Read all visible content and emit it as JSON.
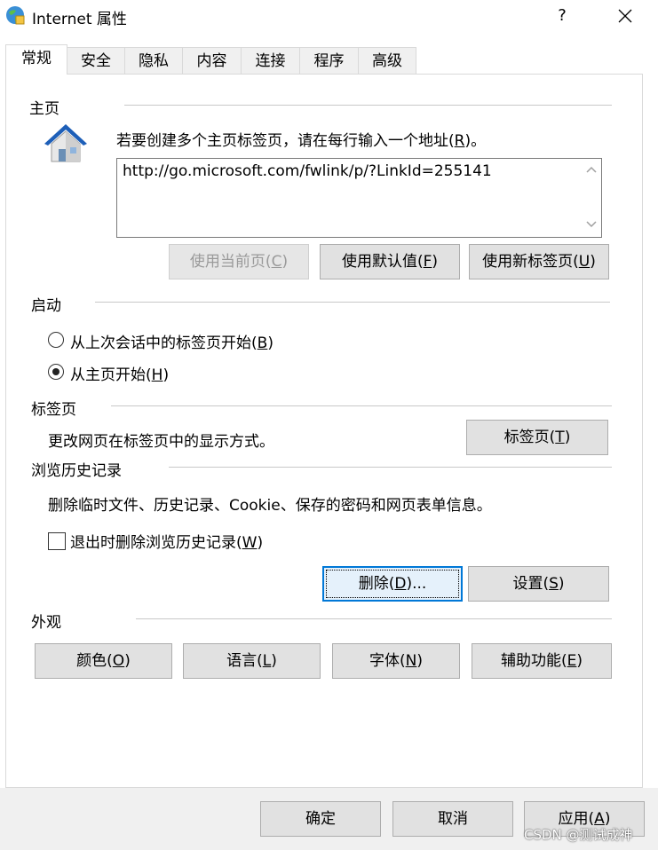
{
  "window": {
    "title": "Internet 属性",
    "help": "?",
    "close": "✕"
  },
  "tabs": [
    {
      "label": "常规",
      "active": true
    },
    {
      "label": "安全",
      "active": false
    },
    {
      "label": "隐私",
      "active": false
    },
    {
      "label": "内容",
      "active": false
    },
    {
      "label": "连接",
      "active": false
    },
    {
      "label": "程序",
      "active": false
    },
    {
      "label": "高级",
      "active": false
    }
  ],
  "home": {
    "section": "主页",
    "instruction_pre": "若要创建多个主页标签页，请在每行输入一个地址(",
    "instruction_key": "R",
    "instruction_post": ")。",
    "url_value": "http://go.microsoft.com/fwlink/p/?LinkId=255141",
    "btn_current": {
      "pre": "使用当前页(",
      "key": "C",
      "post": ")"
    },
    "btn_default": {
      "pre": "使用默认值(",
      "key": "F",
      "post": ")"
    },
    "btn_newtab": {
      "pre": "使用新标签页(",
      "key": "U",
      "post": ")"
    }
  },
  "startup": {
    "section": "启动",
    "opt_last": {
      "pre": "从上次会话中的标签页开始(",
      "key": "B",
      "post": ")"
    },
    "opt_home": {
      "pre": "从主页开始(",
      "key": "H",
      "post": ")"
    }
  },
  "tabs_section": {
    "section": "标签页",
    "desc": "更改网页在标签页中的显示方式。",
    "btn": {
      "pre": "标签页(",
      "key": "T",
      "post": ")"
    }
  },
  "history": {
    "section": "浏览历史记录",
    "desc": "删除临时文件、历史记录、Cookie、保存的密码和网页表单信息。",
    "checkbox": {
      "pre": "退出时删除浏览历史记录(",
      "key": "W",
      "post": ")"
    },
    "btn_delete": {
      "pre": "删除(",
      "key": "D",
      "post": ")..."
    },
    "btn_settings": {
      "pre": "设置(",
      "key": "S",
      "post": ")"
    }
  },
  "appearance": {
    "section": "外观",
    "btn_colors": {
      "pre": "颜色(",
      "key": "O",
      "post": ")"
    },
    "btn_language": {
      "pre": "语言(",
      "key": "L",
      "post": ")"
    },
    "btn_fonts": {
      "pre": "字体(",
      "key": "N",
      "post": ")"
    },
    "btn_access": {
      "pre": "辅助功能(",
      "key": "E",
      "post": ")"
    }
  },
  "footer": {
    "ok": "确定",
    "cancel": "取消",
    "apply": {
      "pre": "应用(",
      "key": "A",
      "post": ")"
    }
  },
  "watermark": "CSDN @测试成神"
}
